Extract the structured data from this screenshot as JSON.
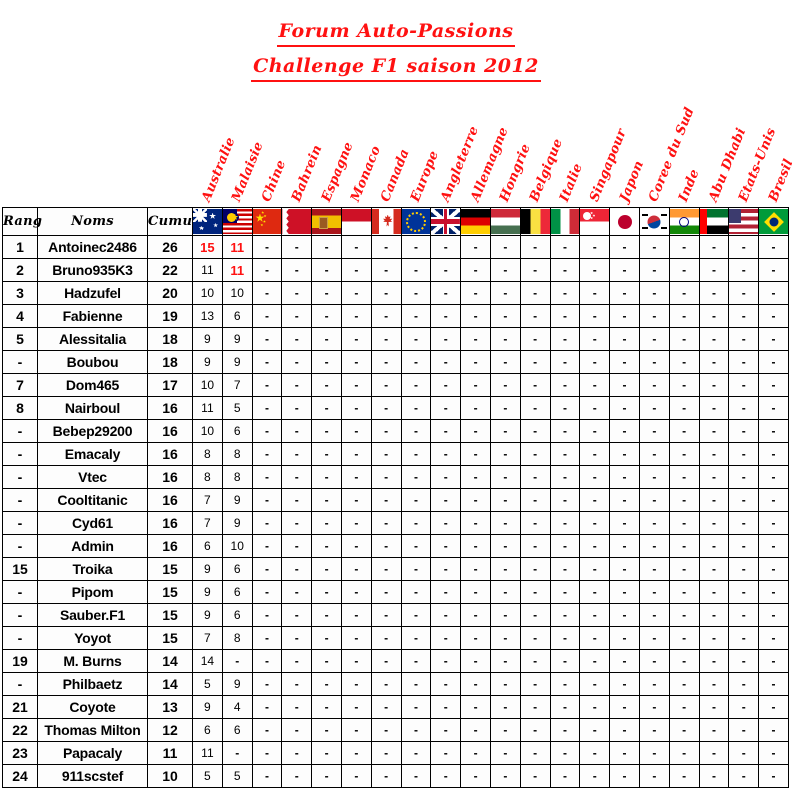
{
  "title": {
    "line1": "Forum Auto-Passions",
    "line2": "Challenge F1 saison 2012",
    "color": "#FF1111"
  },
  "table": {
    "header_bg": "#a6d5f7",
    "headers": {
      "rank": "Rang",
      "name": "Noms",
      "cumul": "Cumul"
    },
    "races": [
      {
        "label": "Australie",
        "flag": "au"
      },
      {
        "label": "Malaisie",
        "flag": "my"
      },
      {
        "label": "Chine",
        "flag": "cn"
      },
      {
        "label": "Bahrein",
        "flag": "bh"
      },
      {
        "label": "Espagne",
        "flag": "es"
      },
      {
        "label": "Monaco",
        "flag": "mc"
      },
      {
        "label": "Canada",
        "flag": "ca"
      },
      {
        "label": "Europe",
        "flag": "eu"
      },
      {
        "label": "Angleterre",
        "flag": "gb"
      },
      {
        "label": "Allemagne",
        "flag": "de"
      },
      {
        "label": "Hongrie",
        "flag": "hu"
      },
      {
        "label": "Belgique",
        "flag": "be"
      },
      {
        "label": "Italie",
        "flag": "it"
      },
      {
        "label": "Singapour",
        "flag": "sg"
      },
      {
        "label": "Japon",
        "flag": "jp"
      },
      {
        "label": "Coree du Sud",
        "flag": "kr"
      },
      {
        "label": "Inde",
        "flag": "in"
      },
      {
        "label": "Abu Dhabi",
        "flag": "ae"
      },
      {
        "label": "Etats-Unis",
        "flag": "us"
      },
      {
        "label": "Bresil",
        "flag": "br"
      }
    ],
    "rows": [
      {
        "rank": "1",
        "name": "Antoinec2486",
        "cumul": "26",
        "scores": [
          "15",
          "11",
          "-",
          "-",
          "-",
          "-",
          "-",
          "-",
          "-",
          "-",
          "-",
          "-",
          "-",
          "-",
          "-",
          "-",
          "-",
          "-",
          "-",
          "-"
        ],
        "highlight": [
          0,
          1
        ]
      },
      {
        "rank": "2",
        "name": "Bruno935K3",
        "cumul": "22",
        "scores": [
          "11",
          "11",
          "-",
          "-",
          "-",
          "-",
          "-",
          "-",
          "-",
          "-",
          "-",
          "-",
          "-",
          "-",
          "-",
          "-",
          "-",
          "-",
          "-",
          "-"
        ],
        "highlight": [
          1
        ]
      },
      {
        "rank": "3",
        "name": "Hadzufel",
        "cumul": "20",
        "scores": [
          "10",
          "10",
          "-",
          "-",
          "-",
          "-",
          "-",
          "-",
          "-",
          "-",
          "-",
          "-",
          "-",
          "-",
          "-",
          "-",
          "-",
          "-",
          "-",
          "-"
        ],
        "highlight": []
      },
      {
        "rank": "4",
        "name": "Fabienne",
        "cumul": "19",
        "scores": [
          "13",
          "6",
          "-",
          "-",
          "-",
          "-",
          "-",
          "-",
          "-",
          "-",
          "-",
          "-",
          "-",
          "-",
          "-",
          "-",
          "-",
          "-",
          "-",
          "-"
        ],
        "highlight": []
      },
      {
        "rank": "5",
        "name": "Alessitalia",
        "cumul": "18",
        "scores": [
          "9",
          "9",
          "-",
          "-",
          "-",
          "-",
          "-",
          "-",
          "-",
          "-",
          "-",
          "-",
          "-",
          "-",
          "-",
          "-",
          "-",
          "-",
          "-",
          "-"
        ],
        "highlight": []
      },
      {
        "rank": "-",
        "name": "Boubou",
        "cumul": "18",
        "scores": [
          "9",
          "9",
          "-",
          "-",
          "-",
          "-",
          "-",
          "-",
          "-",
          "-",
          "-",
          "-",
          "-",
          "-",
          "-",
          "-",
          "-",
          "-",
          "-",
          "-"
        ],
        "highlight": []
      },
      {
        "rank": "7",
        "name": "Dom465",
        "cumul": "17",
        "scores": [
          "10",
          "7",
          "-",
          "-",
          "-",
          "-",
          "-",
          "-",
          "-",
          "-",
          "-",
          "-",
          "-",
          "-",
          "-",
          "-",
          "-",
          "-",
          "-",
          "-"
        ],
        "highlight": []
      },
      {
        "rank": "8",
        "name": "Nairboul",
        "cumul": "16",
        "scores": [
          "11",
          "5",
          "-",
          "-",
          "-",
          "-",
          "-",
          "-",
          "-",
          "-",
          "-",
          "-",
          "-",
          "-",
          "-",
          "-",
          "-",
          "-",
          "-",
          "-"
        ],
        "highlight": []
      },
      {
        "rank": "-",
        "name": "Bebep29200",
        "cumul": "16",
        "scores": [
          "10",
          "6",
          "-",
          "-",
          "-",
          "-",
          "-",
          "-",
          "-",
          "-",
          "-",
          "-",
          "-",
          "-",
          "-",
          "-",
          "-",
          "-",
          "-",
          "-"
        ],
        "highlight": []
      },
      {
        "rank": "-",
        "name": "Emacaly",
        "cumul": "16",
        "scores": [
          "8",
          "8",
          "-",
          "-",
          "-",
          "-",
          "-",
          "-",
          "-",
          "-",
          "-",
          "-",
          "-",
          "-",
          "-",
          "-",
          "-",
          "-",
          "-",
          "-"
        ],
        "highlight": []
      },
      {
        "rank": "-",
        "name": "Vtec",
        "cumul": "16",
        "scores": [
          "8",
          "8",
          "-",
          "-",
          "-",
          "-",
          "-",
          "-",
          "-",
          "-",
          "-",
          "-",
          "-",
          "-",
          "-",
          "-",
          "-",
          "-",
          "-",
          "-"
        ],
        "highlight": []
      },
      {
        "rank": "-",
        "name": "Cooltitanic",
        "cumul": "16",
        "scores": [
          "7",
          "9",
          "-",
          "-",
          "-",
          "-",
          "-",
          "-",
          "-",
          "-",
          "-",
          "-",
          "-",
          "-",
          "-",
          "-",
          "-",
          "-",
          "-",
          "-"
        ],
        "highlight": []
      },
      {
        "rank": "-",
        "name": "Cyd61",
        "cumul": "16",
        "scores": [
          "7",
          "9",
          "-",
          "-",
          "-",
          "-",
          "-",
          "-",
          "-",
          "-",
          "-",
          "-",
          "-",
          "-",
          "-",
          "-",
          "-",
          "-",
          "-",
          "-"
        ],
        "highlight": []
      },
      {
        "rank": "-",
        "name": "Admin",
        "cumul": "16",
        "scores": [
          "6",
          "10",
          "-",
          "-",
          "-",
          "-",
          "-",
          "-",
          "-",
          "-",
          "-",
          "-",
          "-",
          "-",
          "-",
          "-",
          "-",
          "-",
          "-",
          "-"
        ],
        "highlight": []
      },
      {
        "rank": "15",
        "name": "Troika",
        "cumul": "15",
        "scores": [
          "9",
          "6",
          "-",
          "-",
          "-",
          "-",
          "-",
          "-",
          "-",
          "-",
          "-",
          "-",
          "-",
          "-",
          "-",
          "-",
          "-",
          "-",
          "-",
          "-"
        ],
        "highlight": []
      },
      {
        "rank": "-",
        "name": "Pipom",
        "cumul": "15",
        "scores": [
          "9",
          "6",
          "-",
          "-",
          "-",
          "-",
          "-",
          "-",
          "-",
          "-",
          "-",
          "-",
          "-",
          "-",
          "-",
          "-",
          "-",
          "-",
          "-",
          "-"
        ],
        "highlight": []
      },
      {
        "rank": "-",
        "name": "Sauber.F1",
        "cumul": "15",
        "scores": [
          "9",
          "6",
          "-",
          "-",
          "-",
          "-",
          "-",
          "-",
          "-",
          "-",
          "-",
          "-",
          "-",
          "-",
          "-",
          "-",
          "-",
          "-",
          "-",
          "-"
        ],
        "highlight": []
      },
      {
        "rank": "-",
        "name": "Yoyot",
        "cumul": "15",
        "scores": [
          "7",
          "8",
          "-",
          "-",
          "-",
          "-",
          "-",
          "-",
          "-",
          "-",
          "-",
          "-",
          "-",
          "-",
          "-",
          "-",
          "-",
          "-",
          "-",
          "-"
        ],
        "highlight": []
      },
      {
        "rank": "19",
        "name": "M. Burns",
        "cumul": "14",
        "scores": [
          "14",
          "-",
          "-",
          "-",
          "-",
          "-",
          "-",
          "-",
          "-",
          "-",
          "-",
          "-",
          "-",
          "-",
          "-",
          "-",
          "-",
          "-",
          "-",
          "-"
        ],
        "highlight": []
      },
      {
        "rank": "-",
        "name": "Philbaetz",
        "cumul": "14",
        "scores": [
          "5",
          "9",
          "-",
          "-",
          "-",
          "-",
          "-",
          "-",
          "-",
          "-",
          "-",
          "-",
          "-",
          "-",
          "-",
          "-",
          "-",
          "-",
          "-",
          "-"
        ],
        "highlight": []
      },
      {
        "rank": "21",
        "name": "Coyote",
        "cumul": "13",
        "scores": [
          "9",
          "4",
          "-",
          "-",
          "-",
          "-",
          "-",
          "-",
          "-",
          "-",
          "-",
          "-",
          "-",
          "-",
          "-",
          "-",
          "-",
          "-",
          "-",
          "-"
        ],
        "highlight": []
      },
      {
        "rank": "22",
        "name": "Thomas Milton",
        "cumul": "12",
        "scores": [
          "6",
          "6",
          "-",
          "-",
          "-",
          "-",
          "-",
          "-",
          "-",
          "-",
          "-",
          "-",
          "-",
          "-",
          "-",
          "-",
          "-",
          "-",
          "-",
          "-"
        ],
        "highlight": []
      },
      {
        "rank": "23",
        "name": "Papacaly",
        "cumul": "11",
        "scores": [
          "11",
          "-",
          "-",
          "-",
          "-",
          "-",
          "-",
          "-",
          "-",
          "-",
          "-",
          "-",
          "-",
          "-",
          "-",
          "-",
          "-",
          "-",
          "-",
          "-"
        ],
        "highlight": []
      },
      {
        "rank": "24",
        "name": "911scstef",
        "cumul": "10",
        "scores": [
          "5",
          "5",
          "-",
          "-",
          "-",
          "-",
          "-",
          "-",
          "-",
          "-",
          "-",
          "-",
          "-",
          "-",
          "-",
          "-",
          "-",
          "-",
          "-",
          "-"
        ],
        "highlight": []
      }
    ]
  }
}
